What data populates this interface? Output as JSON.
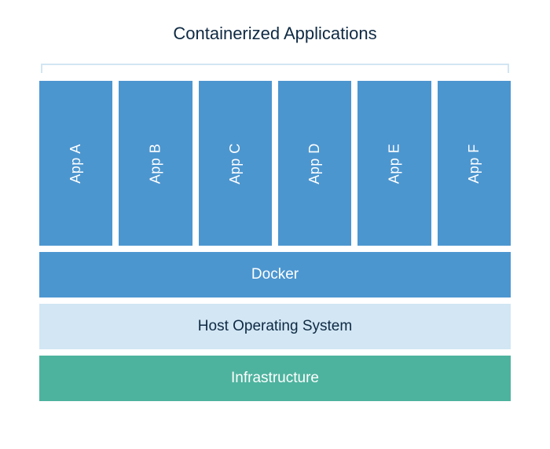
{
  "title": "Containerized Applications",
  "apps": {
    "0": {
      "label": "App A"
    },
    "1": {
      "label": "App B"
    },
    "2": {
      "label": "App C"
    },
    "3": {
      "label": "App D"
    },
    "4": {
      "label": "App E"
    },
    "5": {
      "label": "App F"
    }
  },
  "layers": {
    "docker": "Docker",
    "host_os": "Host Operating System",
    "infrastructure": "Infrastructure"
  },
  "colors": {
    "app_bg": "#4c96d0",
    "docker_bg": "#4c96d0",
    "host_os_bg": "#d2e6f4",
    "infra_bg": "#4db39e",
    "title_text": "#0f2a43"
  },
  "chart_data": {
    "type": "diagram",
    "description": "Docker containerized application architecture stack",
    "stack": [
      {
        "layer": "Applications",
        "items": [
          "App A",
          "App B",
          "App C",
          "App D",
          "App E",
          "App F"
        ]
      },
      {
        "layer": "Docker"
      },
      {
        "layer": "Host Operating System"
      },
      {
        "layer": "Infrastructure"
      }
    ]
  }
}
